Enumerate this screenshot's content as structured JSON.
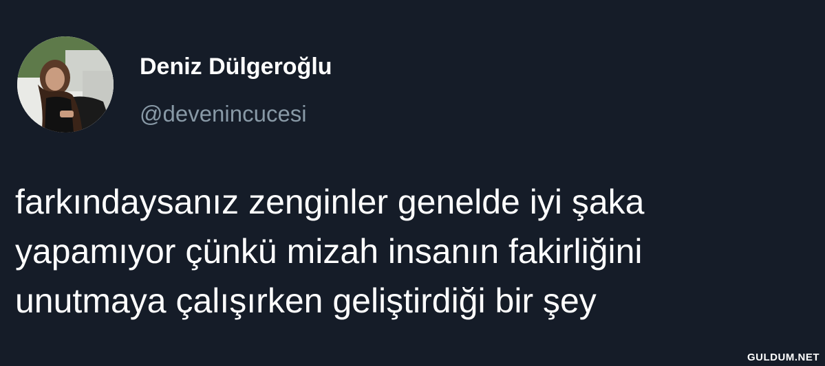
{
  "author": {
    "display_name": "Deniz Dülgeroğlu",
    "handle": "@devenincucesi"
  },
  "tweet": {
    "lines": [
      "farkındaysanız zenginler genelde iyi şaka",
      "yapamıyor çünkü mizah insanın fakirliğini",
      "unutmaya çalışırken geliştirdiği bir şey"
    ]
  },
  "watermark": "GULDUM.NET",
  "colors": {
    "background": "#151c28",
    "text_primary": "#ffffff",
    "text_secondary": "#8899a6"
  }
}
